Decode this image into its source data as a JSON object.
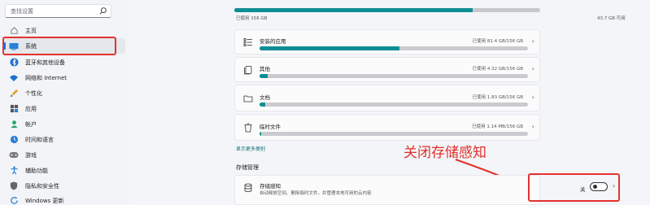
{
  "sidebar": {
    "search_placeholder": "查找设置",
    "items": [
      {
        "label": "主页",
        "icon": "home-icon"
      },
      {
        "label": "系统",
        "icon": "monitor-icon",
        "active": true
      },
      {
        "label": "蓝牙和其他设备",
        "icon": "bluetooth-icon"
      },
      {
        "label": "网络和 Internet",
        "icon": "wifi-icon"
      },
      {
        "label": "个性化",
        "icon": "brush-icon"
      },
      {
        "label": "应用",
        "icon": "apps-icon"
      },
      {
        "label": "帐户",
        "icon": "user-icon"
      },
      {
        "label": "时间和语言",
        "icon": "globe-clock-icon"
      },
      {
        "label": "游戏",
        "icon": "gamepad-icon"
      },
      {
        "label": "辅助功能",
        "icon": "accessibility-icon"
      },
      {
        "label": "隐私和安全性",
        "icon": "shield-icon"
      },
      {
        "label": "Windows 更新",
        "icon": "update-icon"
      }
    ]
  },
  "storage": {
    "used_text": "已使用 156 GB",
    "free_text": "43.7 GB 可用",
    "used_fraction": 0.78,
    "categories": [
      {
        "title": "安装的应用",
        "size": "已使用 81.4 GB/156 GB",
        "fraction": 0.52,
        "icon": "apps-list-icon"
      },
      {
        "title": "其他",
        "size": "已使用 4.32 GB/156 GB",
        "fraction": 0.03,
        "icon": "other-files-icon"
      },
      {
        "title": "文档",
        "size": "已使用 1.83 GB/156 GB",
        "fraction": 0.02,
        "icon": "folder-icon"
      },
      {
        "title": "临时文件",
        "size": "已使用 1.14 MB/156 GB",
        "fraction": 0.005,
        "icon": "trash-icon"
      }
    ],
    "show_more": "显示更多类别"
  },
  "management": {
    "section_title": "存储管理",
    "storage_sense_title": "存储感知",
    "storage_sense_desc": "自动释放空间、删除临时文件，并管理本地可用的云内容",
    "toggle_state": "关"
  },
  "annotation_text": "关闭存储感知",
  "colors": {
    "accent": "#0f8e94",
    "highlight_red": "#e4312f"
  }
}
